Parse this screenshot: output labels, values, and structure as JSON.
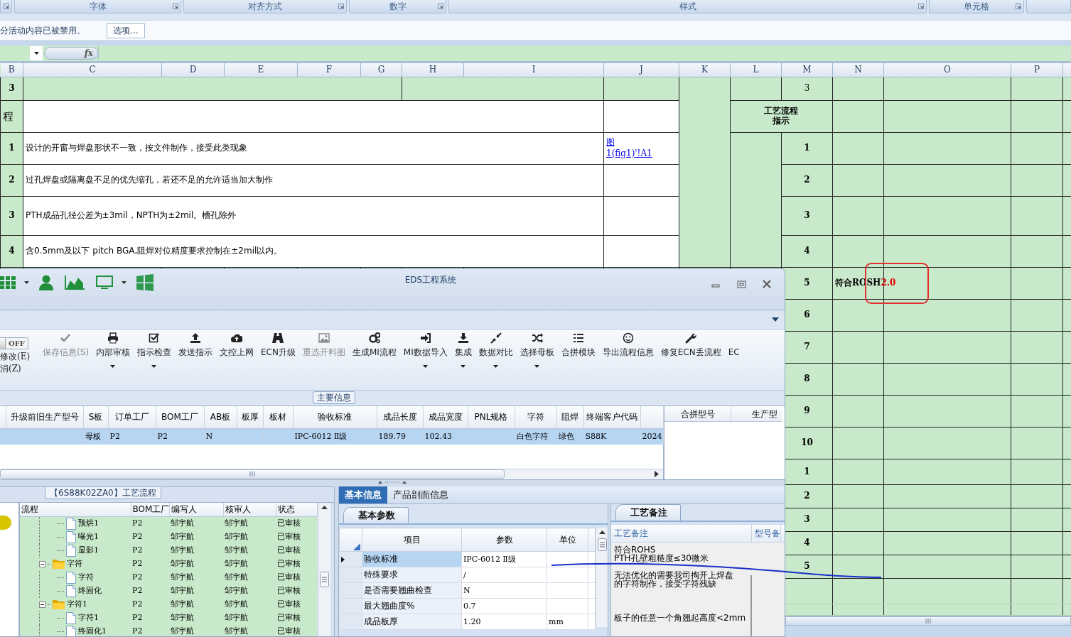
{
  "excel": {
    "ribbon_groups": [
      "字体",
      "对齐方式",
      "数字",
      "样式",
      "单元格"
    ],
    "security_warning": {
      "message": "分活动内容已被禁用。",
      "button": "选项..."
    },
    "formula_bar": {
      "function_label": "fx"
    },
    "columns": [
      "B",
      "C",
      "D",
      "E",
      "F",
      "G",
      "H",
      "I",
      "J",
      "K",
      "L",
      "M",
      "N",
      "O",
      "P"
    ],
    "rows": [
      {
        "kind": "top",
        "b": "3",
        "m": "3"
      },
      {
        "kind": "heading",
        "b": "程",
        "heading": "工艺流程指示"
      },
      {
        "kind": "item",
        "b": "1",
        "text": "设计的开窗与焊盘形状不一致，按文件制作，接受此类现象",
        "link": "图\n1(fig1)'!A1",
        "m": "1"
      },
      {
        "kind": "item",
        "b": "2",
        "text": "过孔焊盘或隔离盘不足的优先缩孔，若还不足的允许适当加大制作",
        "m": "2"
      },
      {
        "kind": "item",
        "b": "3",
        "text": "PTH成品孔径公差为±3mil，NPTH为±2mil。槽孔除外",
        "m": "3"
      },
      {
        "kind": "item",
        "b": "4",
        "text": "含0.5mm及以下 pitch BGA,阻焊对位精度要求控制在±2mil以内。",
        "m": "4"
      },
      {
        "kind": "lower",
        "m": "5",
        "note": {
          "text": "符合ROSH",
          "accent": "2.0"
        }
      },
      {
        "kind": "lower",
        "m": "6"
      },
      {
        "kind": "lower",
        "m": "7"
      },
      {
        "kind": "lower",
        "m": "8"
      },
      {
        "kind": "lower",
        "m": "9"
      },
      {
        "kind": "lower",
        "m": "10"
      },
      {
        "kind": "lower",
        "m": "1"
      },
      {
        "kind": "lower",
        "m": "2"
      },
      {
        "kind": "lower",
        "m": "3"
      },
      {
        "kind": "lower",
        "m": "4"
      },
      {
        "kind": "lower",
        "m": "5"
      }
    ],
    "markups": [
      {
        "kind": "ring"
      },
      {
        "kind": "stroke"
      }
    ]
  },
  "window": {
    "title": "EDS工程系统",
    "ribbon": {
      "toggle": {
        "label": "OFF",
        "on": false
      },
      "side_commands": [
        "修改(E)",
        "消(Z)"
      ],
      "buttons": [
        {
          "label": "保存信息(S)",
          "kind": "check",
          "disabled": true,
          "dropdown": false
        },
        {
          "label": "内部审核",
          "kind": "printer",
          "disabled": false,
          "dropdown": true
        },
        {
          "label": "指示检查",
          "kind": "checkbox",
          "disabled": false,
          "dropdown": true
        },
        {
          "label": "发送指示",
          "kind": "upload",
          "disabled": false,
          "dropdown": false
        },
        {
          "label": "文控上网",
          "kind": "cloud",
          "disabled": false,
          "dropdown": false
        },
        {
          "label": "ECN升级",
          "kind": "road",
          "disabled": false,
          "dropdown": false
        },
        {
          "label": "重选开料图",
          "kind": "image",
          "disabled": true,
          "dropdown": false
        },
        {
          "label": "生成MI流程",
          "kind": "gears",
          "disabled": false,
          "dropdown": false
        },
        {
          "label": "MI数据导入",
          "kind": "signin",
          "disabled": false,
          "dropdown": true
        },
        {
          "label": "集成",
          "kind": "download",
          "disabled": false,
          "dropdown": true
        },
        {
          "label": "数据对比",
          "kind": "compress",
          "disabled": false,
          "dropdown": true
        },
        {
          "label": "选择母板",
          "kind": "shuffle",
          "disabled": false,
          "dropdown": true
        },
        {
          "label": "合拼模块",
          "kind": "list",
          "disabled": false,
          "dropdown": false
        },
        {
          "label": "导出流程信息",
          "kind": "smile",
          "disabled": false,
          "dropdown": false
        },
        {
          "label": "修复ECN丢流程",
          "kind": "wrench",
          "disabled": false,
          "dropdown": false
        },
        {
          "label": "EC",
          "kind": "none",
          "disabled": false,
          "dropdown": false
        }
      ],
      "section_label": "主要信息"
    },
    "main_grid": {
      "columns": [
        "",
        "升级前旧生产型号",
        "S板",
        "订单工厂",
        "BOM工厂",
        "AB板",
        "板厚",
        "板材",
        "验收标准",
        "成品长度",
        "成品宽度",
        "PNL规格",
        "字符",
        "阻焊",
        "终端客户代码",
        ""
      ],
      "rows": [
        {
          "selected": true,
          "cells": [
            null,
            null,
            "母板",
            "P2",
            "P2",
            "N",
            null,
            null,
            "IPC-6012 Ⅱ级",
            "189.79",
            "102.43",
            null,
            "白色字符",
            "绿色",
            "S88K",
            "2024"
          ]
        }
      ]
    },
    "side_grid": {
      "columns": [
        "合拼型号",
        "生产型"
      ]
    },
    "flow_panel": {
      "title": "【6S88K02ZA0】工艺流程",
      "columns": [
        "流程",
        "BOM工厂",
        "编写人",
        "核审人",
        "状态"
      ],
      "tree": [
        {
          "label": "预烘1",
          "kind": "step",
          "bom": "P2",
          "writer": "邹宇航",
          "reviewer": "邹宇航",
          "status": "已审核"
        },
        {
          "label": "曝光1",
          "kind": "step",
          "bom": "P2",
          "writer": "邹宇航",
          "reviewer": "邹宇航",
          "status": "已审核"
        },
        {
          "label": "显影1",
          "kind": "step",
          "bom": "P2",
          "writer": "邹宇航",
          "reviewer": "邹宇航",
          "status": "已审核"
        },
        {
          "label": "字符",
          "kind": "folder",
          "expanded": true,
          "bom": "P2",
          "writer": "邹宇航",
          "reviewer": "邹宇航",
          "status": "已审核",
          "children": [
            {
              "label": "字符",
              "kind": "step",
              "bom": "P2",
              "writer": "邹宇航",
              "reviewer": "邹宇航",
              "status": "已审核"
            },
            {
              "label": "终固化",
              "kind": "step",
              "bom": "P2",
              "writer": "邹宇航",
              "reviewer": "邹宇航",
              "status": "已审核"
            }
          ]
        },
        {
          "label": "字符1",
          "kind": "folder",
          "expanded": true,
          "bom": "P2",
          "writer": "邹宇航",
          "reviewer": "邹宇航",
          "status": "已审核",
          "children": [
            {
              "label": "字符1",
              "kind": "step",
              "bom": "P2",
              "writer": "邹宇航",
              "reviewer": "邹宇航",
              "status": "已审核"
            },
            {
              "label": "终固化1",
              "kind": "step",
              "bom": "P2",
              "writer": "邹宇航",
              "reviewer": "邹宇航",
              "status": "已审核"
            }
          ]
        }
      ]
    },
    "detail_panel": {
      "tabs": [
        {
          "label": "基本信息",
          "selected": true
        },
        {
          "label": "产品剖面信息",
          "selected": false
        }
      ],
      "params": {
        "tab": "基本参数",
        "columns": [
          "项目",
          "参数",
          "单位"
        ],
        "rows": [
          {
            "item": "验收标准",
            "value": "IPC-6012 Ⅱ级",
            "selected": true
          },
          {
            "item": "特殊要求",
            "value": "/",
            "selected": false
          },
          {
            "item": "是否需要翘曲检查",
            "value": "N",
            "selected": false
          },
          {
            "item": "最大翘曲度%",
            "value": "0.7",
            "selected": false
          },
          {
            "item": "成品板厚",
            "value": "1.20",
            "unit": "mm",
            "selected": false
          }
        ]
      },
      "notes": {
        "tab": "工艺备注",
        "columns": [
          "工艺备注",
          "型号备"
        ],
        "paragraphs": [
          "符合ROHS",
          "PTH孔壁粗糙度≤30微米",
          "无法优化的需要我司掏开上焊盘的字符制作，接受字符残缺",
          "板子的任意一个角翘起高度<2mm"
        ]
      }
    }
  }
}
